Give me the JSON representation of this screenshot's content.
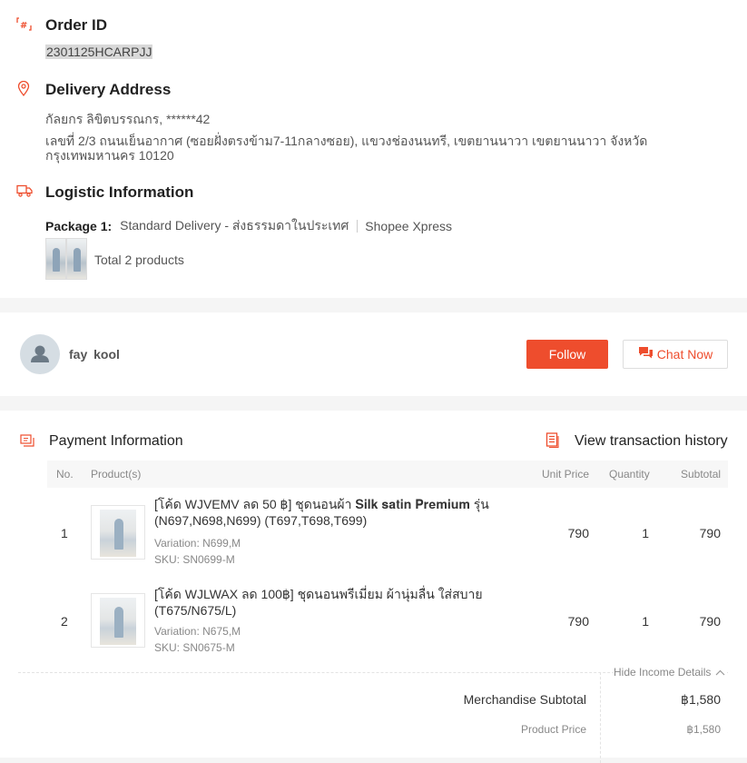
{
  "order": {
    "title": "Order ID",
    "id": "2301125HCARPJJ"
  },
  "delivery": {
    "title": "Delivery Address",
    "name_phone": "กัลยกร ลิขิตบรรณกร, ******42",
    "address": "เลขที่ 2/3 ถนนเย็นอากาศ (ซอยฝั่งตรงข้าม7-11กลางซอย), แขวงช่องนนทรี, เขตยานนาวา เขตยานนาวา จังหวัดกรุงเทพมหานคร 10120"
  },
  "logistic": {
    "title": "Logistic Information",
    "package_label": "Package 1:",
    "service": "Standard Delivery - ส่งธรรมดาในประเทศ",
    "carrier": "Shopee Xpress",
    "total_products": "Total 2 products"
  },
  "seller": {
    "name": "fay  kool",
    "follow_label": "Follow",
    "chat_label": "Chat Now"
  },
  "payment": {
    "title": "Payment Information",
    "view_history_label": "View transaction history",
    "columns": {
      "no": "No.",
      "products": "Product(s)",
      "unit_price": "Unit Price",
      "quantity": "Quantity",
      "subtotal": "Subtotal"
    },
    "rows": [
      {
        "no": "1",
        "name": "[โค้ด WJVEMV ลด 50 ฿] ชุดนอนผ้า 𝐒𝐢𝐥𝐤 𝐬𝐚𝐭𝐢𝐧 𝐏𝐫𝐞𝐦𝐢𝐮𝐦 รุ่น (N697,N698,N699) (T697,T698,T699)",
        "variation": "Variation: N699,M",
        "sku": "SKU: SN0699-M",
        "unit_price": "790",
        "quantity": "1",
        "subtotal": "790"
      },
      {
        "no": "2",
        "name": "[โค้ด WJLWAX ลด 100฿] ชุดนอนพรีเมี่ยม ผ้านุ่มลื่น ใส่สบาย (T675/N675/L)",
        "variation": "Variation: N675,M",
        "sku": "SKU: SN0675-M",
        "unit_price": "790",
        "quantity": "1",
        "subtotal": "790"
      }
    ],
    "hide_income_label": "Hide Income Details",
    "summary": [
      {
        "label": "Merchandise Subtotal",
        "value": "฿1,580"
      },
      {
        "label": "Product Price",
        "value": "฿1,580"
      }
    ]
  },
  "colors": {
    "accent": "#ee4d2d",
    "page_bg": "#f5f5f5"
  },
  "icons": {
    "order": "order-id-icon",
    "location": "location-pin-icon",
    "truck": "truck-icon",
    "payment": "payment-icon",
    "history": "transaction-history-icon",
    "chat": "chat-icon",
    "chevron": "chevron-up-icon"
  }
}
